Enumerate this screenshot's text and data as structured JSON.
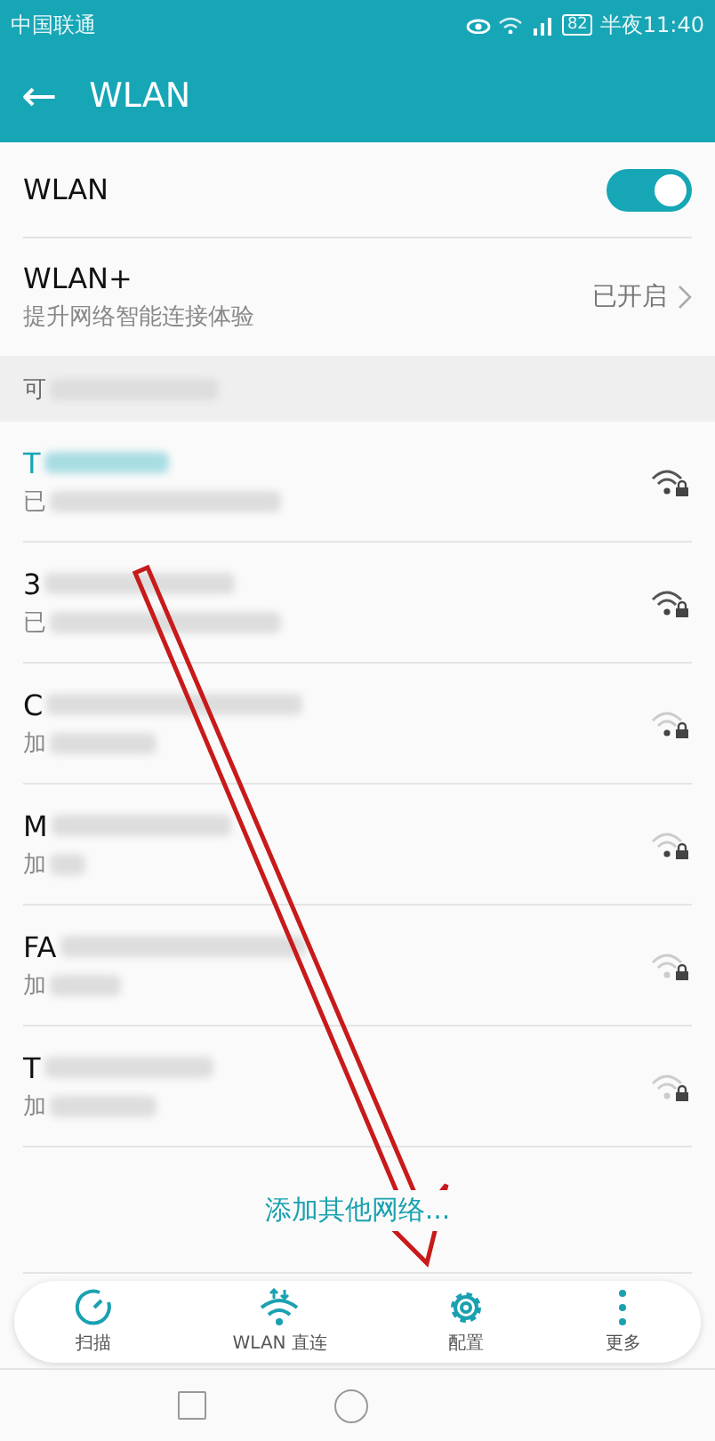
{
  "status_bar": {
    "carrier": "中国联通",
    "battery": "82",
    "time": "半夜11:40"
  },
  "app_bar": {
    "back": "←",
    "title": "WLAN"
  },
  "wlan": {
    "label": "WLAN",
    "on": true
  },
  "wlan_plus": {
    "label": "WLAN+",
    "subtitle": "提升网络智能连接体验",
    "value": "已开启"
  },
  "section": {
    "title": "可"
  },
  "networks": [
    {
      "name": "T",
      "status": "已",
      "selected": true
    },
    {
      "name": "3",
      "status": "已",
      "selected": false
    },
    {
      "name": "C",
      "status": "加",
      "selected": false
    },
    {
      "name": "M",
      "status": "加",
      "selected": false
    },
    {
      "name": "FA",
      "status": "加",
      "selected": false
    },
    {
      "name": "T",
      "status": "加",
      "selected": false
    }
  ],
  "add_network": "添加其他网络...",
  "toolbar": [
    {
      "kind": "scan",
      "label": "扫描"
    },
    {
      "kind": "direct",
      "label": "WLAN 直连"
    },
    {
      "kind": "settings",
      "label": "配置"
    },
    {
      "kind": "more",
      "label": "更多"
    }
  ]
}
